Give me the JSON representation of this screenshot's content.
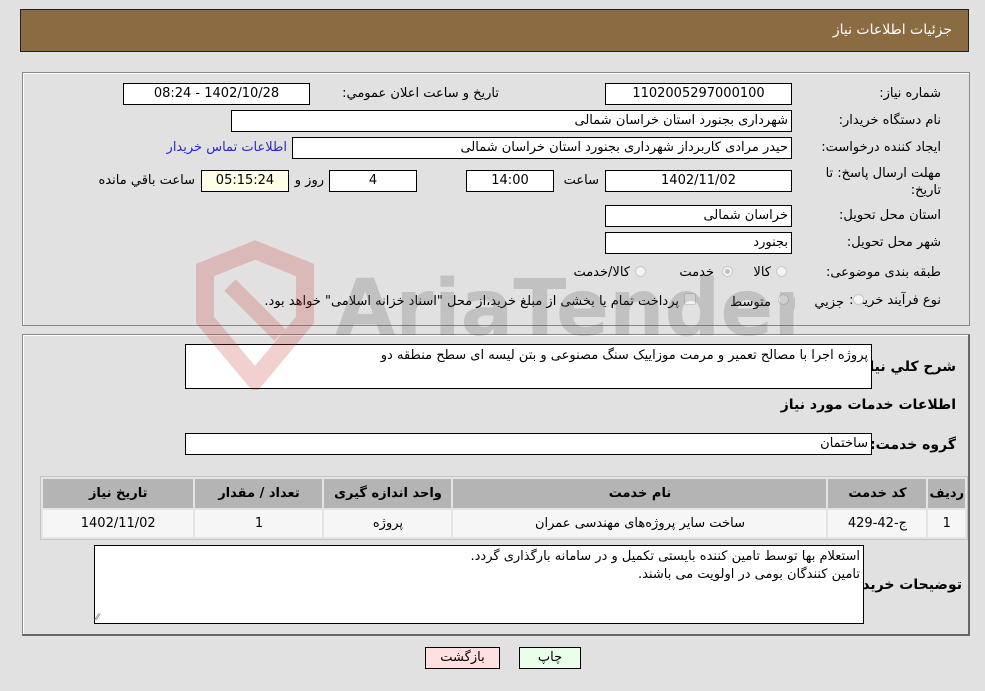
{
  "header": {
    "title": "جزئیات اطلاعات نیاز"
  },
  "details": {
    "need_number_label": "شماره نیاز:",
    "need_number": "1102005297000100",
    "announce_label": "تاريخ و ساعت اعلان عمومي:",
    "announce_value": "1402/10/28 - 08:24",
    "buyer_org_label": "نام دستگاه خريدار:",
    "buyer_org": "شهرداری بجنورد استان خراسان شمالی",
    "creator_label": "ايجاد کننده درخواست:",
    "creator": "حیدر مرادی کاربرداز  شهرداری بجنورد استان خراسان شمالی",
    "contact_link": "اطلاعات تماس خريدار",
    "deadline_label": "مهلت ارسال پاسخ: تا تاريخ:",
    "deadline_date": "1402/11/02",
    "time_label": "ساعت",
    "deadline_time": "14:00",
    "days_value": "4",
    "days_label": "روز و",
    "remaining_time": "05:15:24",
    "remaining_label": "ساعت باقي مانده",
    "province_label": "استان محل تحويل:",
    "province": "خراسان شمالی",
    "city_label": "شهر محل تحويل:",
    "city": "بجنورد",
    "category_label": "طبقه بندی موضوعی:",
    "category_options": [
      {
        "label": "کالا",
        "checked": false
      },
      {
        "label": "خدمت",
        "checked": true
      },
      {
        "label": "کالا/خدمت",
        "checked": false
      }
    ],
    "purchase_type_label": "نوع فرآيند خريد :",
    "purchase_type_options": [
      {
        "label": "جزيي",
        "checked": false
      },
      {
        "label": "متوسط",
        "checked": false
      }
    ],
    "payment_note": "پرداخت تمام يا بخشی از مبلغ خريد،از محل \"اسناد خزانه اسلامی\" خواهد بود."
  },
  "description": {
    "label": "شرح کلي نياز:",
    "value": "پروژه اجرا با مصالح تعمیر و مرمت موزاییک سنگ مصنوعی و بتن لیسه ای سطح منطقه دو"
  },
  "services": {
    "section_title": "اطلاعات خدمات مورد نياز",
    "group_label": "گروه خدمت:",
    "group_value": "ساختمان",
    "columns": [
      "رديف",
      "کد خدمت",
      "نام خدمت",
      "واحد اندازه گيری",
      "تعداد / مقدار",
      "تاريخ نياز"
    ],
    "rows": [
      [
        "1",
        "ج-42-429",
        "ساخت سایر پروژه‌های مهندسی عمران",
        "پروژه",
        "1",
        "1402/11/02"
      ]
    ]
  },
  "buyer_notes": {
    "label": "توضيحات خريدار:",
    "value": "استعلام بها توسط تامین کننده بایستی تکمیل و در سامانه بارگذاری گردد.\nتامین کنندگان بومی در اولویت می باشند."
  },
  "buttons": {
    "print": "چاپ",
    "back": "بازگشت"
  },
  "colors": {
    "header": "#8b6b42",
    "link": "#2a2acc",
    "back_button": "#ffe0e0",
    "print_button": "#eaffea"
  },
  "watermark": "AriaTender.neT"
}
